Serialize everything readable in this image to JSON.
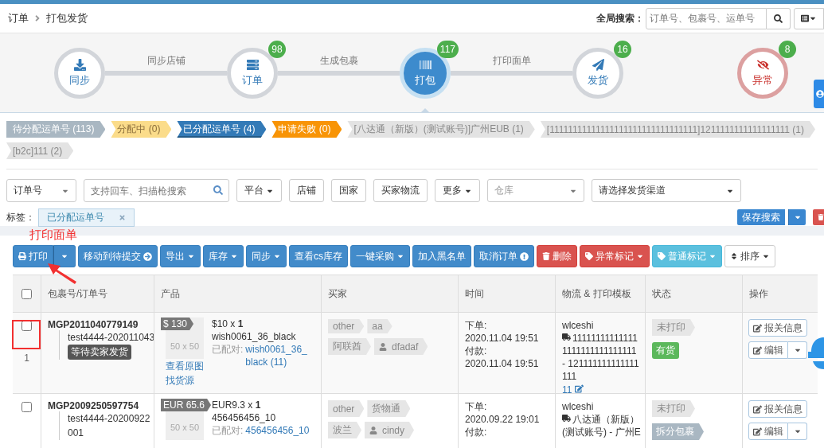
{
  "breadcrumb": [
    "订单",
    "打包发货"
  ],
  "global_search": {
    "label": "全局搜索：",
    "placeholder": "订单号、包裹号、运单号"
  },
  "workflow": {
    "steps": [
      {
        "label": "同步",
        "kind": "normal",
        "selected": false
      },
      {
        "label": "订单",
        "count": "98",
        "kind": "normal",
        "selected": false
      },
      {
        "label": "打包",
        "count": "117",
        "kind": "normal",
        "selected": true
      },
      {
        "label": "发货",
        "count": "16",
        "kind": "normal",
        "selected": false
      },
      {
        "label": "异常",
        "count": "8",
        "kind": "alert",
        "selected": false
      }
    ],
    "connectors": [
      "同步店铺",
      "生成包裹",
      "打印面单"
    ]
  },
  "tabs": [
    {
      "label": "待分配运单号 (113)",
      "kind": "muted",
      "selected": false
    },
    {
      "label": "分配中 (0)",
      "kind": "warning",
      "selected": false
    },
    {
      "label": "已分配运单号 (4)",
      "kind": "primary",
      "selected": true
    },
    {
      "label": "申请失败 (0)",
      "kind": "danger",
      "selected": false
    },
    {
      "label": "[八达通（新版）(测试账号)]广州EUB (1)",
      "kind": "plain",
      "selected": false
    },
    {
      "label": "[11111111111111111111111111111111]1211111111111111111 (1)",
      "kind": "plain",
      "selected": false
    },
    {
      "label": "[b2c]111 (2)",
      "kind": "plain",
      "selected": false
    }
  ],
  "filters": {
    "order_type": "订单号",
    "search_placeholder": "支持回车、扫描枪搜索",
    "buttons": [
      {
        "label": "平台",
        "dropdown": true
      },
      {
        "label": "店铺",
        "dropdown": false
      },
      {
        "label": "国家",
        "dropdown": false
      },
      {
        "label": "买家物流",
        "dropdown": false
      },
      {
        "label": "更多",
        "dropdown": true
      }
    ],
    "warehouse_placeholder": "仓库",
    "channel_placeholder": "请选择发货渠道"
  },
  "tags": {
    "label": "标签：",
    "items": [
      "已分配运单号"
    ],
    "save_search": "保存搜索"
  },
  "annotation": "打印面单",
  "toolbar": [
    {
      "label": "打印",
      "kind": "primary",
      "split": true,
      "dropdown": false
    },
    {
      "label": "移动到待提交",
      "kind": "primary",
      "dropdown": false
    },
    {
      "label": "导出",
      "kind": "primary",
      "dropdown": true
    },
    {
      "label": "库存",
      "kind": "primary",
      "dropdown": true
    },
    {
      "label": "同步",
      "kind": "primary",
      "dropdown": true
    },
    {
      "label": "查看cs库存",
      "kind": "primary",
      "dropdown": false
    },
    {
      "label": "一键采购",
      "kind": "primary",
      "dropdown": true
    },
    {
      "label": "加入黑名单",
      "kind": "primary",
      "dropdown": false
    },
    {
      "label": "取消订单",
      "kind": "primary",
      "dropdown": false
    },
    {
      "label": "删除",
      "kind": "danger",
      "dropdown": false
    },
    {
      "label": "异常标记",
      "kind": "danger",
      "dropdown": true
    },
    {
      "label": "普通标记",
      "kind": "info",
      "dropdown": true
    },
    {
      "label": "排序",
      "kind": "default",
      "dropdown": true
    }
  ],
  "table": {
    "all_checked": false,
    "columns": [
      "包裹号/订单号",
      "产品",
      "买家",
      "时间",
      "物流 & 打印模板",
      "状态",
      "操作"
    ],
    "rows": [
      {
        "checked": false,
        "package": "MGP2011040779149",
        "order": "test4444-202011043",
        "order_status": "等待卖家发货",
        "index": "1",
        "price": "$ 130",
        "thumb": "50 x 50",
        "links": [
          "查看原图",
          "找货源"
        ],
        "unit": "$10 x **1**",
        "sku": "wish0061_36_black",
        "matched_label": "已配对:",
        "matched": "wish0061_36_black (11)",
        "buyer": [
          [
            "other",
            "aa"
          ],
          [
            "阿联酋"
          ]
        ],
        "buyer_user": "dfadaf",
        "time": [
          "下单:",
          "2020.11.04 19:51",
          "付款:",
          "2020.11.04 19:51"
        ],
        "account": "wlceshi",
        "channel": "111111111111111111111111111111 - 121111111111111111",
        "tracking": "11",
        "print_status": "未打印",
        "stock": {
          "label": "有货",
          "kind": "success"
        },
        "actions": [
          "报关信息",
          "编辑"
        ]
      },
      {
        "checked": false,
        "package": "MGP2009250597754",
        "order": "test4444-20200922001",
        "price": "EUR 65.6",
        "thumb": "50 x 50",
        "unit": "EUR9.3 x **1**",
        "sku": "456456456_10",
        "matched_label": "已配对:",
        "matched": "456456456_10",
        "buyer": [
          [
            "other",
            "货物通"
          ],
          [
            "波兰"
          ]
        ],
        "buyer_user": "cindy",
        "time": [
          "下单:",
          "2020.09.22 19:01",
          "付款:"
        ],
        "account": "wlceshi",
        "channel": "八达通（新版）(测试账号) - 广州E",
        "print_status": "未打印",
        "stock": {
          "label": "拆分包裹",
          "kind": "split"
        },
        "actions": [
          "报关信息",
          "编辑"
        ]
      }
    ]
  }
}
